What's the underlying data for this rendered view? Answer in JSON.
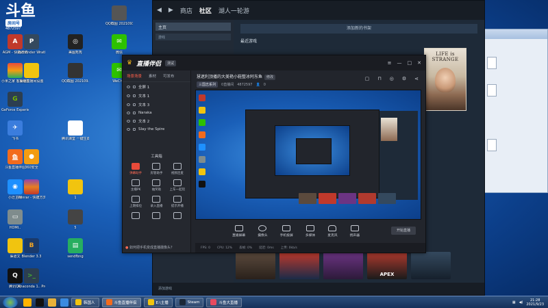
{
  "desktop": {
    "logo": {
      "big": "斗鱼",
      "pill": "房间号",
      "num": "4872597"
    },
    "icons": [
      {
        "label": "AGM - 快捷方式"
      },
      {
        "label": "Pathfinder Wrath o..."
      },
      {
        "label": "美图秀秀"
      },
      {
        "label": "QQ截图 2021093..."
      },
      {
        "label": ""
      },
      {
        "label": "微信"
      },
      {
        "label": "小米之家 客服编辑"
      },
      {
        "label": "渠道直播间设置"
      },
      {
        "label": "QQ截图 202109..."
      },
      {
        "label": "WeChat"
      },
      {
        "label": "GeForce Experience"
      },
      {
        "label": ""
      },
      {
        "label": "飞书"
      },
      {
        "label": "腾讯课堂 一键生成..."
      },
      {
        "label": "斗鱼直播伴侣"
      },
      {
        "label": "360安全"
      },
      {
        "label": ""
      },
      {
        "label": "小迁主场"
      },
      {
        "label": "Winrar - 快捷方式"
      },
      {
        "label": "1"
      },
      {
        "label": "HDMI.."
      },
      {
        "label": ""
      },
      {
        "label": "5"
      },
      {
        "label": "渠道文"
      },
      {
        "label": "Blender 3.3"
      },
      {
        "label": "sendfbng"
      },
      {
        "label": "腾讯QQ"
      },
      {
        "label": "Anaconda 1.. Prompt"
      }
    ]
  },
  "steam": {
    "nav": [
      "商店",
      "社区",
      "湖人一轮游"
    ],
    "home": "主页",
    "filter": "游戏",
    "add_shelf": "添加新的书架",
    "recent_games": "最近游戏",
    "card_title": "LIFE is STRANGE",
    "add_game": "添加游戏",
    "thumbs": [
      "",
      "",
      "",
      "APEX",
      ""
    ]
  },
  "obs": {
    "brand": "直播伴侣",
    "version": "测试",
    "tabs": [
      "场景场景",
      "素材",
      "可发布"
    ],
    "scenes": [
      "全屏 1",
      "文本 1",
      "文本 3",
      "Naraka",
      "文本 2",
      "Slay the Spire"
    ],
    "tools_title": "工具箱",
    "tools": [
      {
        "label": "弹幕助手",
        "red": true
      },
      {
        "label": "房管助手",
        "red": false
      },
      {
        "label": "视频连麦",
        "red": false
      },
      {
        "label": "主播PK",
        "red": false
      },
      {
        "label": "抽奖助",
        "red": false
      },
      {
        "label": "上车一起玩",
        "red": false
      },
      {
        "label": "上期排位",
        "red": false
      },
      {
        "label": "录入直播",
        "red": false
      },
      {
        "label": "提示开播",
        "red": false
      },
      {
        "label": "",
        "red": false
      },
      {
        "label": "",
        "red": false
      },
      {
        "label": "",
        "red": false
      }
    ],
    "hint": "如何把手机变成直播摄像头？",
    "stream_title": "慧遮利顶播的大美艳小鞋整冰阿东鱼",
    "stream_tag": "修改",
    "category": "三国志系列",
    "room_label": "0直播间",
    "room_id": "4872597",
    "viewers": "0",
    "controls": [
      "直播屏幕",
      "摄像头",
      "手机投屏",
      "多媒体",
      "麦克风",
      "扬声器"
    ],
    "live_button": "开始直播",
    "status": [
      "FPS: 0",
      "CPU: 12%",
      "丢帧: 0%",
      "延迟: 0ms",
      "上传: 0kb/s"
    ]
  },
  "taskbar": {
    "tasks": [
      "韩国人",
      "斗鱼直播伴侣",
      "E:\\主播",
      "Steam",
      "斗鱼大直播"
    ],
    "time": "21:28",
    "date": "2021/9/23"
  }
}
